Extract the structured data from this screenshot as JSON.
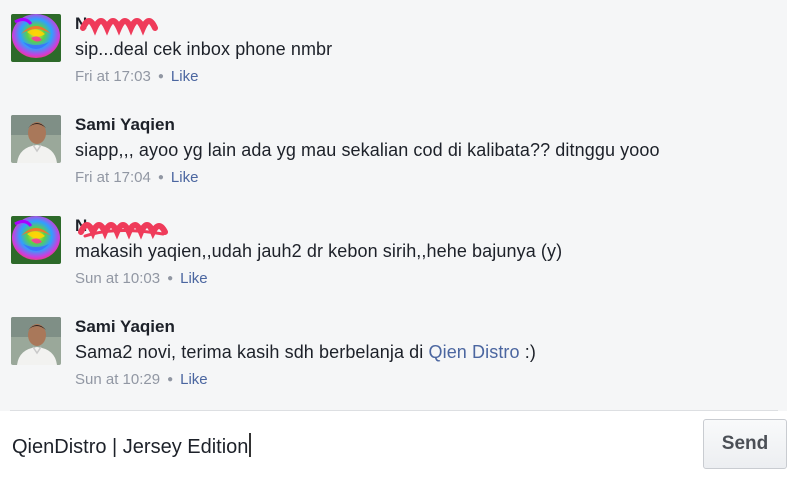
{
  "comments": [
    {
      "avatar": "rainbow-rose-avatar",
      "author": "N",
      "author_redacted": true,
      "text_pre": "sip...deal cek inbox phone nmbr",
      "text_link": "",
      "text_post": "",
      "time": "Fri at 17:03",
      "like": "Like"
    },
    {
      "avatar": "man-photo-avatar",
      "author": "Sami Yaqien",
      "author_redacted": false,
      "text_pre": "siapp,,, ayoo yg lain ada yg mau sekalian cod di kalibata?? ditnggu yooo",
      "text_link": "",
      "text_post": "",
      "time": "Fri at 17:04",
      "like": "Like"
    },
    {
      "avatar": "rainbow-rose-avatar",
      "author": "N",
      "author_redacted": true,
      "text_pre": "makasih yaqien,,udah jauh2 dr kebon sirih,,hehe bajunya (y)",
      "text_link": "",
      "text_post": "",
      "time": "Sun at 10:03",
      "like": "Like"
    },
    {
      "avatar": "man-photo-avatar",
      "author": "Sami Yaqien",
      "author_redacted": false,
      "text_pre": "Sama2 novi, terima kasih sdh berbelanja di ",
      "text_link": "Qien Distro",
      "text_post": " :)",
      "time": "Sun at 10:29",
      "like": "Like"
    }
  ],
  "composer": {
    "value": "QienDistro | Jersey Edition",
    "send_label": "Send"
  },
  "colors": {
    "link": "#4b66a0",
    "meta": "#9197a3",
    "redaction": "#ef3b5a"
  }
}
